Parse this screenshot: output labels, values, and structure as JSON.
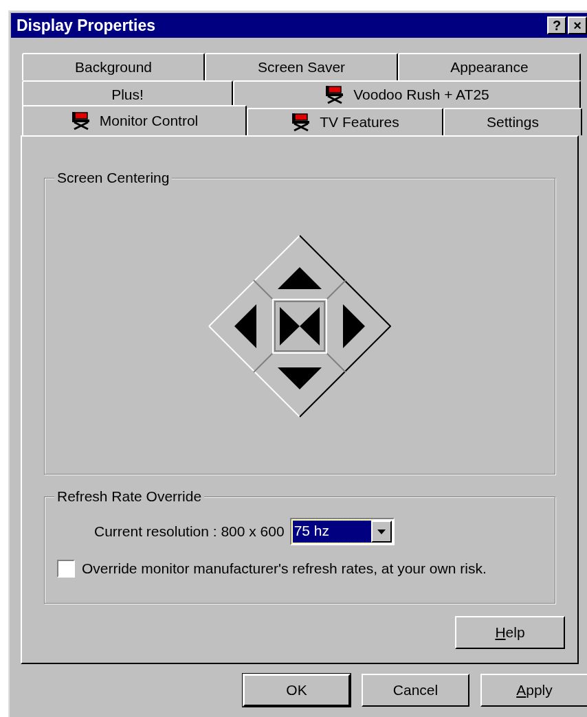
{
  "window": {
    "title": "Display Properties",
    "title_buttons": [
      "?",
      "×"
    ]
  },
  "tab_rows": [
    {
      "tabs": [
        {
          "label": "Background",
          "icon": false,
          "selected": false
        },
        {
          "label": "Screen Saver",
          "icon": false,
          "selected": false
        },
        {
          "label": "Appearance",
          "icon": false,
          "selected": false
        }
      ]
    },
    {
      "tabs": [
        {
          "label": "Plus!",
          "icon": false,
          "selected": false
        },
        {
          "label": "Voodoo Rush + AT25",
          "icon": true,
          "selected": false
        }
      ]
    },
    {
      "tabs": [
        {
          "label": "Monitor Control",
          "icon": true,
          "selected": true
        },
        {
          "label": "TV Features",
          "icon": true,
          "selected": false
        },
        {
          "label": "Settings",
          "icon": false,
          "selected": false
        }
      ]
    }
  ],
  "screen_centering": {
    "title": "Screen Centering"
  },
  "refresh_rate": {
    "title": "Refresh Rate Override",
    "resolution_label": "Current resolution : 800 x 600",
    "rate": {
      "value": "75 hz",
      "focused": true
    },
    "override": {
      "label": "Override monitor manufacturer's refresh rates, at your own risk.",
      "checked": false
    }
  },
  "help_button": {
    "label": "Help",
    "underline_first": true
  },
  "buttons": [
    {
      "label": "OK",
      "default": true,
      "underline_first": false
    },
    {
      "label": "Cancel",
      "default": false,
      "underline_first": false
    },
    {
      "label": "Apply",
      "default": false,
      "underline_first": true
    }
  ]
}
